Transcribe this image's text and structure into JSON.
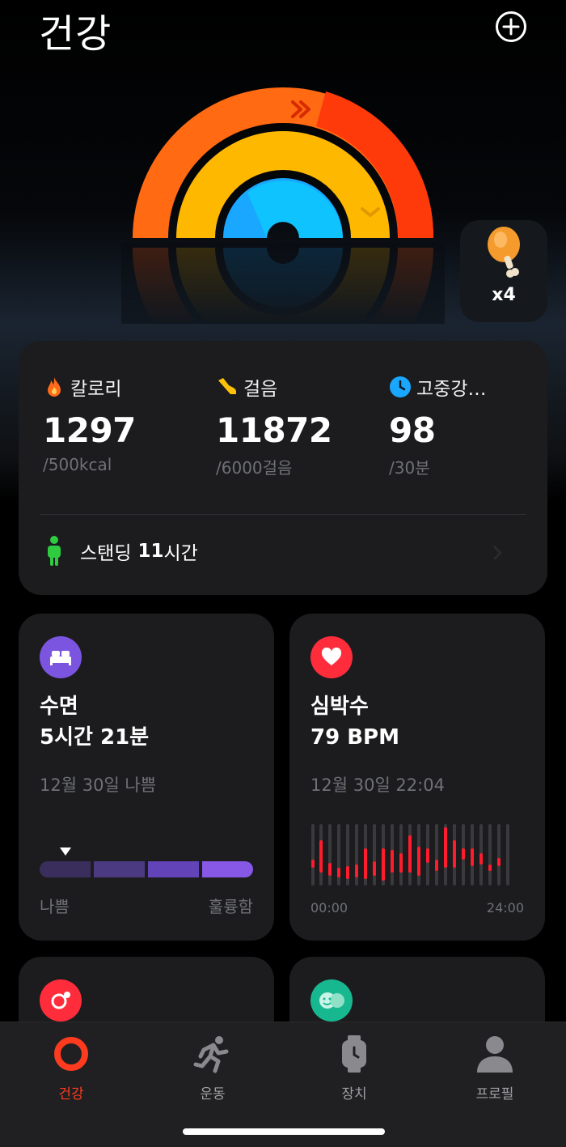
{
  "header": {
    "title": "건강"
  },
  "bonus": {
    "count": "x4"
  },
  "activity": {
    "calories": {
      "label": "칼로리",
      "value": "1297",
      "goal": "/500kcal",
      "color": "#ff6a1a"
    },
    "steps": {
      "label": "걸음",
      "value": "11872",
      "goal": "/6000걸음",
      "color": "#ffc107"
    },
    "intensity": {
      "label": "고중강…",
      "value": "98",
      "goal": "/30분",
      "color": "#1aa7ff"
    },
    "standing": {
      "label": "스탠딩",
      "value": "11",
      "unit": "시간"
    }
  },
  "sleep": {
    "title": "수면",
    "duration": "5시간 21분",
    "date_status": "12월 30일 나쁨",
    "low_label": "나쁨",
    "high_label": "훌륭함",
    "quality_level": 0.125
  },
  "heart_rate": {
    "title": "심박수",
    "value": "79 BPM",
    "timestamp": "12월 30일 22:04",
    "axis_start": "00:00",
    "axis_end": "24:00"
  },
  "tabs": [
    {
      "label": "건강",
      "icon": "ring-icon",
      "active": true
    },
    {
      "label": "운동",
      "icon": "running-icon",
      "active": false
    },
    {
      "label": "장치",
      "icon": "watch-icon",
      "active": false
    },
    {
      "label": "프로필",
      "icon": "person-icon",
      "active": false
    }
  ]
}
